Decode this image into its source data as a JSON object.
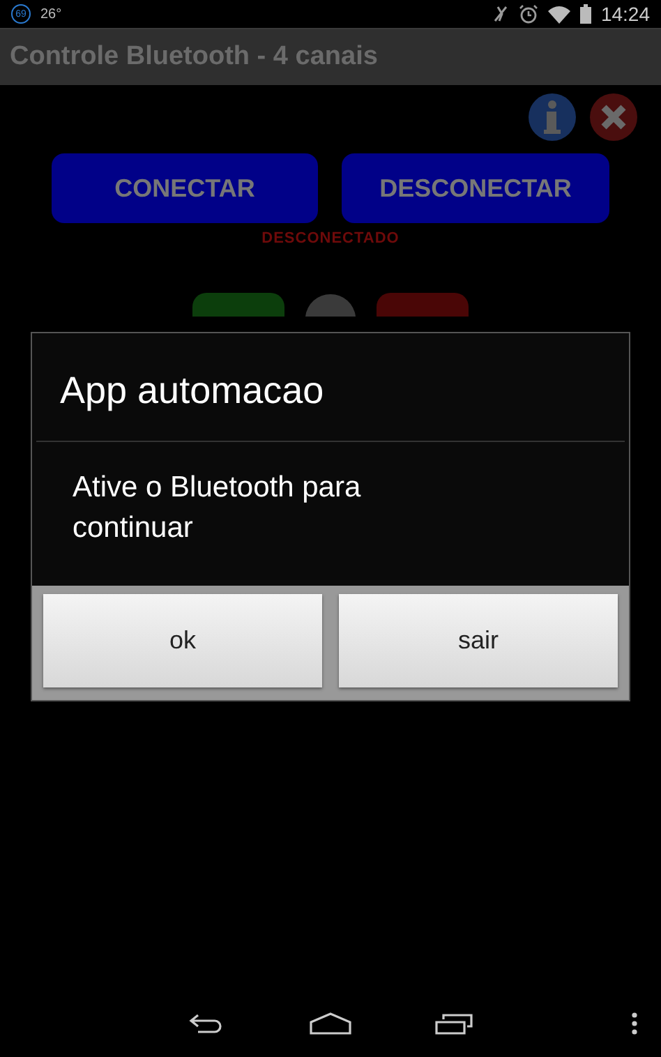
{
  "status_bar": {
    "badge": "69",
    "temperature": "26°",
    "time": "14:24"
  },
  "app_bar": {
    "title": "Controle Bluetooth - 4 canais"
  },
  "connect_buttons": [
    "CONECTAR",
    "DESCONECTAR"
  ],
  "connection_status": "DESCONECTADO",
  "dialog": {
    "title": "App automacao",
    "message": "Ative o Bluetooth para continuar",
    "buttons": [
      "ok",
      "sair"
    ]
  }
}
